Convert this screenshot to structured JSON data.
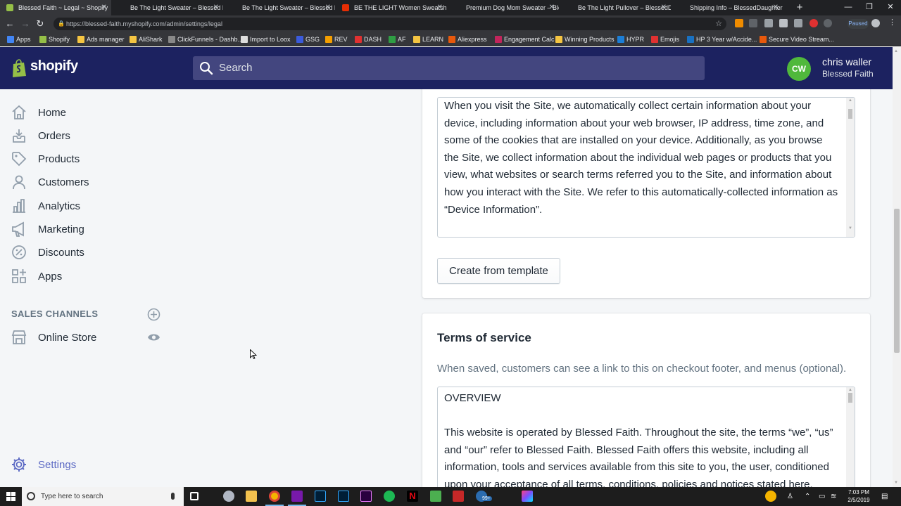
{
  "browser": {
    "tabs": [
      {
        "title": "Blessed Faith ~ Legal ~ Shopify",
        "fav_color": "#95bf47",
        "active": true
      },
      {
        "title": "Be The Light Sweater – Blessed Faith",
        "fav_color": "#202124"
      },
      {
        "title": "Be The Light Sweater – Blessed Faith",
        "fav_color": "#202124"
      },
      {
        "title": "BE THE LIGHT Women Sweatshirt",
        "fav_color": "#e62e04"
      },
      {
        "title": "Premium Dog Mom Sweater – Blessed",
        "fav_color": "#202124"
      },
      {
        "title": "Be The Light Pullover – BlessedDaughter",
        "fav_color": "#202124"
      },
      {
        "title": "Shipping Info – BlessedDaughter",
        "fav_color": "#202124"
      }
    ],
    "url": "https://blessed-faith.myshopify.com/admin/settings/legal",
    "paused_label": "Paused",
    "bookmarks": [
      {
        "label": "Apps",
        "color": "#4285f4"
      },
      {
        "label": "Shopify",
        "color": "#95bf47"
      },
      {
        "label": "Ads manager",
        "color": "#f5c542"
      },
      {
        "label": "AliShark",
        "color": "#f5c542"
      },
      {
        "label": "ClickFunnels - Dashb...",
        "color": "#888888"
      },
      {
        "label": "Import to Loox",
        "color": "#dddddd"
      },
      {
        "label": "GSG",
        "color": "#3b5bdb"
      },
      {
        "label": "REV",
        "color": "#f59f00"
      },
      {
        "label": "DASH",
        "color": "#e03131"
      },
      {
        "label": "AF",
        "color": "#2f9e44"
      },
      {
        "label": "LEARN",
        "color": "#f5c542"
      },
      {
        "label": "Aliexpress",
        "color": "#e8590c"
      },
      {
        "label": "Engagement Calc",
        "color": "#c2255c"
      },
      {
        "label": "Winning Products",
        "color": "#f5c542"
      },
      {
        "label": "HYPR",
        "color": "#1c7ed6"
      },
      {
        "label": "Emojis",
        "color": "#e03131"
      },
      {
        "label": "HP 3 Year w/Accide...",
        "color": "#1971c2"
      },
      {
        "label": "Secure Video Stream...",
        "color": "#e8590c"
      }
    ]
  },
  "header": {
    "logo_text": "shopify",
    "search_placeholder": "Search",
    "user_initials": "CW",
    "user_name": "chris waller",
    "store_name": "Blessed Faith"
  },
  "sidebar": {
    "items": [
      {
        "label": "Home",
        "icon": "home-icon"
      },
      {
        "label": "Orders",
        "icon": "orders-icon"
      },
      {
        "label": "Products",
        "icon": "tag-icon"
      },
      {
        "label": "Customers",
        "icon": "person-icon"
      },
      {
        "label": "Analytics",
        "icon": "bar-chart-icon"
      },
      {
        "label": "Marketing",
        "icon": "megaphone-icon"
      },
      {
        "label": "Discounts",
        "icon": "discount-icon"
      },
      {
        "label": "Apps",
        "icon": "apps-icon"
      }
    ],
    "sales_channels_heading": "SALES CHANNELS",
    "online_store_label": "Online Store",
    "settings_label": "Settings"
  },
  "privacy_card": {
    "text": "When you visit the Site, we automatically collect certain information about your device, including information about your web browser, IP address, time zone, and some of the cookies that are installed on your device. Additionally, as you browse the Site, we collect information about the individual web pages or products that you view, what websites or search terms referred you to the Site, and information about how you interact with the Site. We refer to this automatically-collected information as “Device Information”.",
    "button_label": "Create from template"
  },
  "terms_card": {
    "title": "Terms of service",
    "subtitle": "When saved, customers can see a link to this on checkout footer, and menus (optional).",
    "heading_line": "OVERVIEW",
    "text": "This website is operated by Blessed Faith. Throughout the site, the terms “we”, “us” and “our” refer to Blessed Faith. Blessed Faith offers this website, including all information, tools and services available from this site to you, the user, conditioned upon your acceptance of all terms, conditions, policies and notices stated here."
  },
  "taskbar": {
    "search_placeholder": "Type here to search",
    "time": "7:03 PM",
    "date": "2/5/2019",
    "badge": "99+"
  }
}
